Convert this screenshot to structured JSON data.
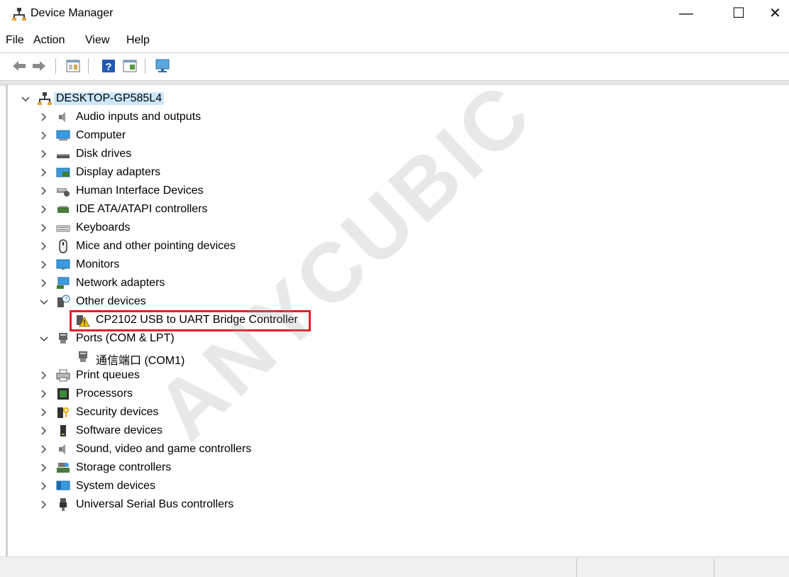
{
  "window": {
    "title": "Device Manager",
    "minimize": "—",
    "maximize": "☐",
    "close": "✕"
  },
  "menu": [
    "File",
    "Action",
    "View",
    "Help"
  ],
  "toolbar": {
    "buttons": [
      "back-icon",
      "forward-icon",
      "properties-icon",
      "help-icon",
      "update-driver-icon",
      "scan-hardware-icon"
    ]
  },
  "tree": {
    "root": "DESKTOP-GP585L4",
    "items": [
      {
        "label": "Audio inputs and outputs",
        "icon": "speaker-icon",
        "expanded": false
      },
      {
        "label": "Computer",
        "icon": "computer-icon",
        "expanded": false
      },
      {
        "label": "Disk drives",
        "icon": "disk-drive-icon",
        "expanded": false
      },
      {
        "label": "Display adapters",
        "icon": "display-adapter-icon",
        "expanded": false
      },
      {
        "label": "Human Interface Devices",
        "icon": "hid-icon",
        "expanded": false
      },
      {
        "label": "IDE ATA/ATAPI controllers",
        "icon": "ide-controller-icon",
        "expanded": false
      },
      {
        "label": "Keyboards",
        "icon": "keyboard-icon",
        "expanded": false
      },
      {
        "label": "Mice and other pointing devices",
        "icon": "mouse-icon",
        "expanded": false
      },
      {
        "label": "Monitors",
        "icon": "monitor-icon",
        "expanded": false
      },
      {
        "label": "Network adapters",
        "icon": "network-adapter-icon",
        "expanded": false
      },
      {
        "label": "Other devices",
        "icon": "unknown-device-icon",
        "expanded": true
      },
      {
        "label": "CP2102 USB to UART Bridge Controller",
        "icon": "warning-device-icon",
        "child": true
      },
      {
        "label": "Ports (COM & LPT)",
        "icon": "port-icon",
        "expanded": true
      },
      {
        "label": "通信端口 (COM1)",
        "icon": "port-icon",
        "child": true
      },
      {
        "label": "Print queues",
        "icon": "printer-icon",
        "expanded": false
      },
      {
        "label": "Processors",
        "icon": "processor-icon",
        "expanded": false
      },
      {
        "label": "Security devices",
        "icon": "security-device-icon",
        "expanded": false
      },
      {
        "label": "Software devices",
        "icon": "software-device-icon",
        "expanded": false
      },
      {
        "label": "Sound, video and game controllers",
        "icon": "sound-controller-icon",
        "expanded": false
      },
      {
        "label": "Storage controllers",
        "icon": "storage-controller-icon",
        "expanded": false
      },
      {
        "label": "System devices",
        "icon": "system-device-icon",
        "expanded": false
      },
      {
        "label": "Universal Serial Bus controllers",
        "icon": "usb-icon",
        "expanded": false
      }
    ]
  },
  "watermark": "ANYCUBIC",
  "colors": {
    "highlight_border": "#e41f26",
    "selection": "#cce8ff"
  }
}
